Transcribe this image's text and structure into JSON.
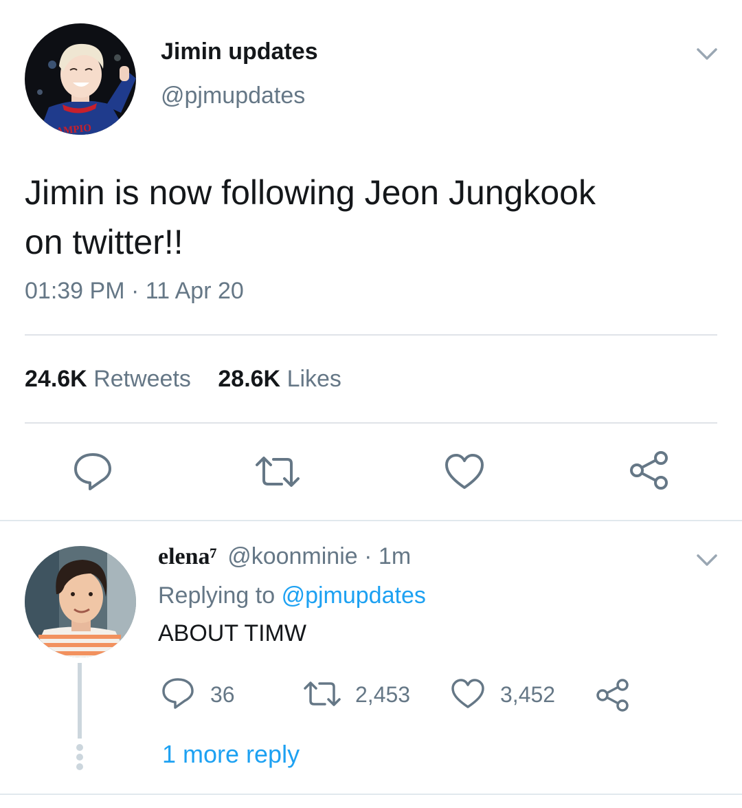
{
  "tweet": {
    "display_name": "Jimin updates",
    "handle": "@pjmupdates",
    "text_line1": "Jimin is now following Jeon Jungkook",
    "text_line2": "on twitter!!",
    "timestamp": "01:39 PM · 11 Apr 20",
    "retweets_count": "24.6K",
    "retweets_label": "Retweets",
    "likes_count": "28.6K",
    "likes_label": "Likes",
    "avatar_shirt_text": "AMPIO"
  },
  "reply": {
    "display_name": "elena⁷",
    "handle": "@koonminie",
    "time": "· 1m",
    "replying_prefix": "Replying to",
    "replying_handle": "@pjmupdates",
    "text": "ABOUT TIMW",
    "reply_count": "36",
    "retweet_count": "2,453",
    "like_count": "3,452",
    "more_replies": "1 more reply"
  },
  "colors": {
    "text": "#14171a",
    "muted": "#657786",
    "link": "#1da1f2",
    "icon": "#657786",
    "divider": "#dfe3e8",
    "thread_line": "#ccd6dd"
  },
  "icons": [
    "chevron-down-icon",
    "reply-icon",
    "retweet-icon",
    "like-icon",
    "share-icon"
  ]
}
